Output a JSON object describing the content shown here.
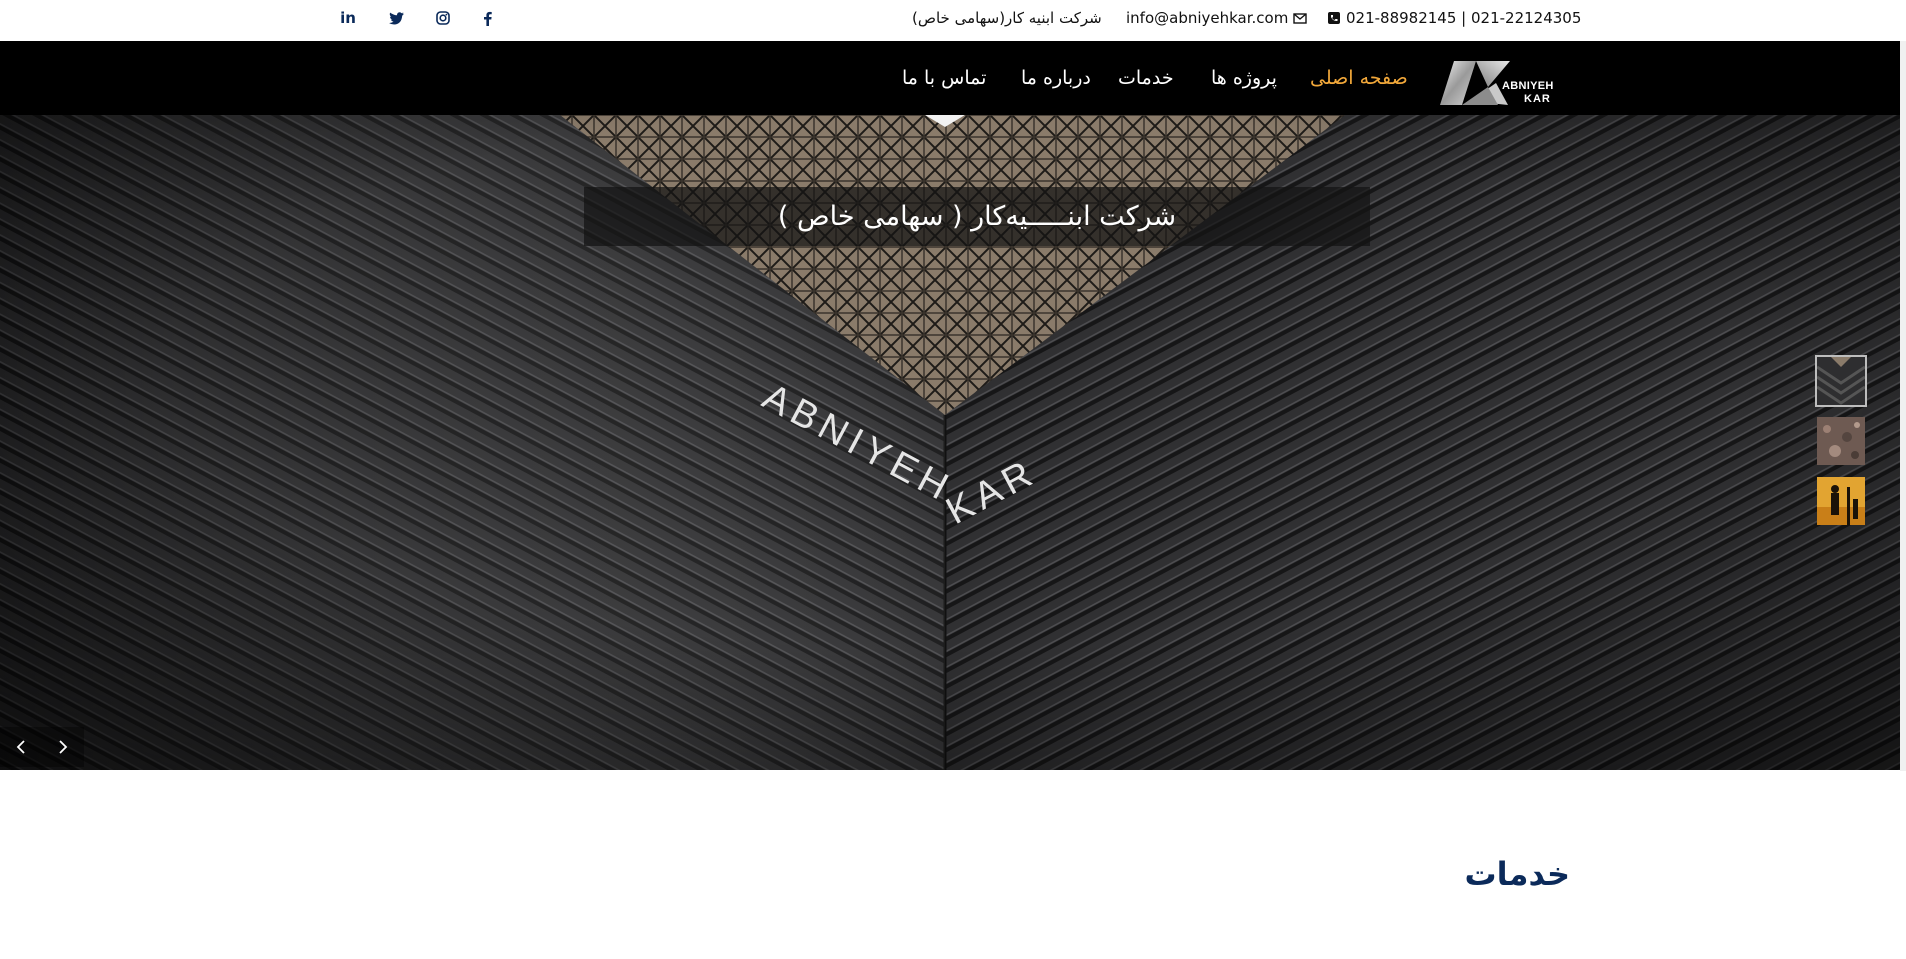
{
  "topbar": {
    "phone": "021-88982145 | 021-22124305",
    "email": "info@abniyehkar.com",
    "company": "شرکت ابنیه کار(سهامی خاص)",
    "social": [
      {
        "name": "linkedin-icon",
        "glyph": "in"
      },
      {
        "name": "twitter-icon",
        "glyph": "t"
      },
      {
        "name": "instagram-icon",
        "glyph": "ig"
      },
      {
        "name": "facebook-icon",
        "glyph": "f"
      }
    ]
  },
  "nav": {
    "logo_line1": "ABNIYEH",
    "logo_line2": "KAR",
    "items": [
      {
        "label": "صفحه اصلی",
        "active": true
      },
      {
        "label": "پروژه ها",
        "active": false
      },
      {
        "label": "خدمات",
        "active": false
      },
      {
        "label": "درباره ما",
        "active": false
      },
      {
        "label": "تماس با ما",
        "active": false
      }
    ]
  },
  "hero": {
    "caption": "شرکت ابنـــــیه‌کار ( سهامی خاص )",
    "sign_text": "ABNIYEH KAR"
  },
  "section": {
    "title": "خدمات"
  },
  "colors": {
    "accent": "#f2a83a",
    "navy": "#0b2a5a",
    "nav_bg": "#000000"
  }
}
